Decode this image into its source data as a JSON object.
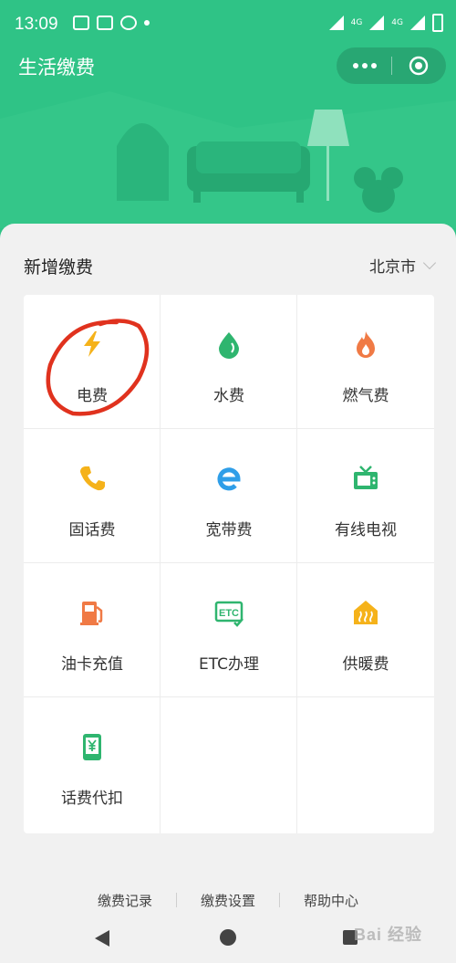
{
  "status_bar": {
    "time": "13:09",
    "net1": "4G",
    "net2": "4G"
  },
  "header": {
    "title": "生活缴费"
  },
  "colors": {
    "brand_green": "#2fc386"
  },
  "section": {
    "title": "新增缴费",
    "city": "北京市"
  },
  "services": [
    {
      "label": "电费",
      "icon": "lightning-icon"
    },
    {
      "label": "水费",
      "icon": "water-drop-icon"
    },
    {
      "label": "燃气费",
      "icon": "flame-icon"
    },
    {
      "label": "固话费",
      "icon": "phone-icon"
    },
    {
      "label": "宽带费",
      "icon": "broadband-e-icon"
    },
    {
      "label": "有线电视",
      "icon": "tv-icon"
    },
    {
      "label": "油卡充值",
      "icon": "fuel-pump-icon"
    },
    {
      "label": "ETC办理",
      "icon": "etc-card-icon"
    },
    {
      "label": "供暖费",
      "icon": "heating-house-icon"
    },
    {
      "label": "话费代扣",
      "icon": "mobile-yuan-icon"
    }
  ],
  "footer": {
    "records": "缴费记录",
    "settings": "缴费设置",
    "help": "帮助中心"
  },
  "watermark": "Bai 经验"
}
